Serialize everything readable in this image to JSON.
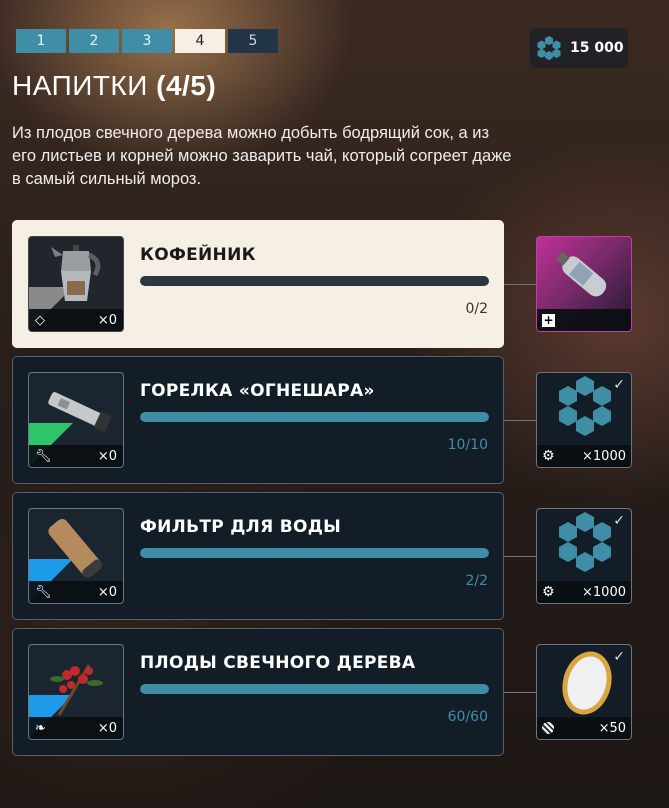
{
  "tabs": [
    {
      "label": "1",
      "state": "done"
    },
    {
      "label": "2",
      "state": "done"
    },
    {
      "label": "3",
      "state": "done"
    },
    {
      "label": "4",
      "state": "active"
    },
    {
      "label": "5",
      "state": "locked"
    }
  ],
  "currency": {
    "icon": "hex-cluster-icon",
    "amount": "15 000"
  },
  "title": {
    "main": "НАПИТКИ",
    "count": "(4/5)"
  },
  "description": "Из плодов свечного дерева можно добыть бодрящий сок, а из его листьев и корней можно заварить чай, который согреет даже в самый сильный мороз.",
  "items": [
    {
      "name": "КОФЕЙНИК",
      "progress": "0/2",
      "fraction": 0,
      "owned": "×0",
      "type_icon": "diamond-icon",
      "accent": "#8a8a8a",
      "reward": {
        "art": "gas-canister",
        "icon": "plus-box-icon",
        "amount": "",
        "claimed": false
      }
    },
    {
      "name": "ГОРЕЛКА «ОГНЕШАРА»",
      "progress": "10/10",
      "fraction": 1,
      "owned": "×0",
      "type_icon": "wrench-icon",
      "accent": "#2ec46a",
      "reward": {
        "art": "hex-cluster",
        "icon": "gear-icon",
        "amount": "×1000",
        "claimed": true
      }
    },
    {
      "name": "ФИЛЬТР ДЛЯ ВОДЫ",
      "progress": "2/2",
      "fraction": 1,
      "owned": "×0",
      "type_icon": "wrench-icon",
      "accent": "#1e9be8",
      "reward": {
        "art": "hex-cluster",
        "icon": "gear-icon",
        "amount": "×1000",
        "claimed": true
      }
    },
    {
      "name": "ПЛОДЫ СВЕЧНОГО ДЕРЕВА",
      "progress": "60/60",
      "fraction": 1,
      "owned": "×0",
      "type_icon": "leaf-icon",
      "accent": "#1e9be8",
      "reward": {
        "art": "salt-plate",
        "icon": "striped-ball-icon",
        "amount": "×50",
        "claimed": true
      }
    }
  ],
  "check_glyph": "✓"
}
